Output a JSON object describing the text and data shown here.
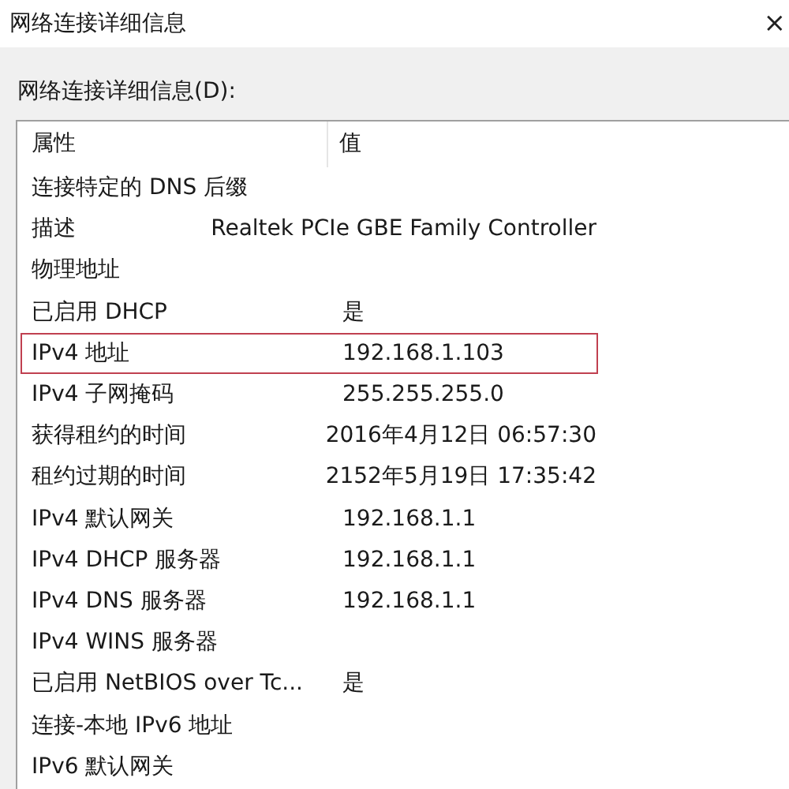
{
  "window": {
    "title": "网络连接详细信息",
    "close": "×"
  },
  "list_label": "网络连接详细信息(D):",
  "table": {
    "columns": [
      "属性",
      "值"
    ],
    "rows": [
      {
        "property": "连接特定的 DNS 后缀",
        "highlighted": false
      },
      {
        "property": "描述",
        "value": "Realtek PCIe GBE Family Controller",
        "highlighted": false
      },
      {
        "property": "物理地址",
        "highlighted": false
      },
      {
        "property": "已启用 DHCP",
        "value": "是",
        "highlighted": false
      },
      {
        "property": "IPv4 地址",
        "value": "192.168.1.103",
        "highlighted": true
      },
      {
        "property": "IPv4 子网掩码",
        "value": "255.255.255.0",
        "highlighted": false
      },
      {
        "property": "获得租约的时间",
        "value": "2016年4月12日 06:57:30",
        "highlighted": false
      },
      {
        "property": "租约过期的时间",
        "value": "2152年5月19日 17:35:42",
        "highlighted": false
      },
      {
        "property": "IPv4 默认网关",
        "value": "192.168.1.1",
        "highlighted": false
      },
      {
        "property": "IPv4 DHCP 服务器",
        "value": "192.168.1.1",
        "highlighted": false
      },
      {
        "property": "IPv4 DNS 服务器",
        "value": "192.168.1.1",
        "highlighted": false
      },
      {
        "property": "IPv4 WINS 服务器",
        "highlighted": false
      },
      {
        "property": "已启用 NetBIOS over Tc...",
        "value": "是",
        "highlighted": false
      },
      {
        "property": "连接-本地 IPv6 地址",
        "highlighted": false
      },
      {
        "property": "IPv6 默认网关",
        "highlighted": false
      }
    ]
  }
}
